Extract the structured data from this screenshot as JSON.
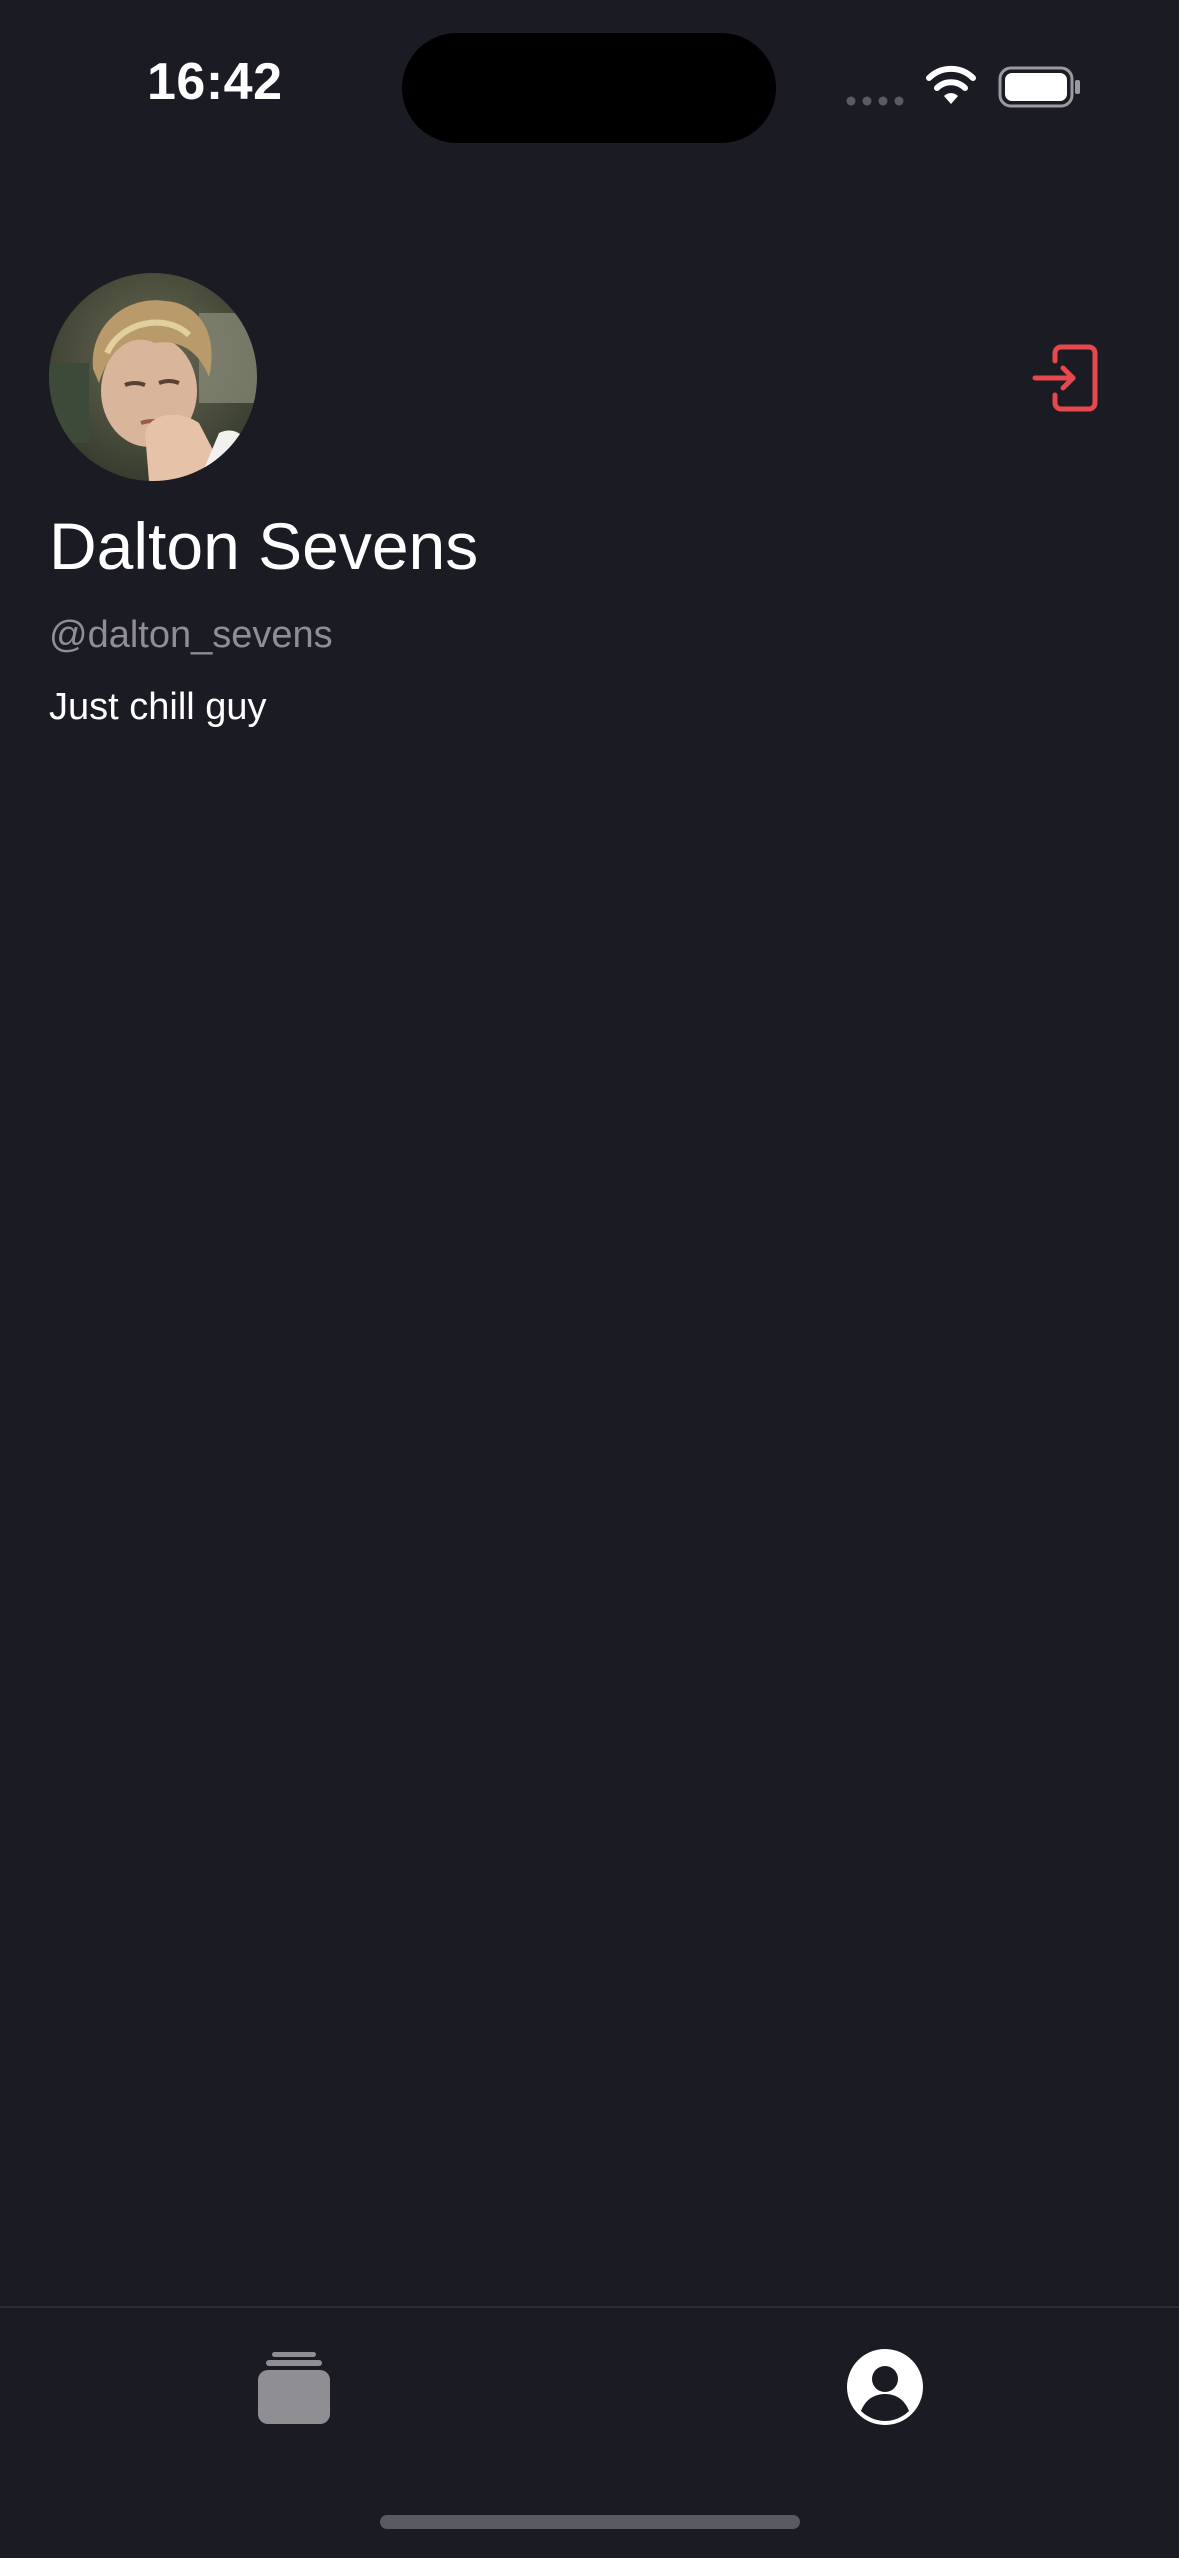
{
  "status_bar": {
    "time": "16:42",
    "signal_icon": "signal-dots-icon",
    "wifi_icon": "wifi-icon",
    "battery_icon": "battery-full-icon"
  },
  "profile": {
    "name": "Dalton Sevens",
    "handle": "@dalton_sevens",
    "bio": "Just chill guy",
    "avatar": "avatar-photo"
  },
  "header": {
    "logout_icon": "logout-icon",
    "accent_color": "#e5484d"
  },
  "tab_bar": {
    "tabs": [
      {
        "name": "feed",
        "icon": "stack-icon",
        "active": false
      },
      {
        "name": "profile",
        "icon": "person-circle-icon",
        "active": true
      }
    ],
    "active_color": "#ffffff",
    "inactive_color": "#8e8e93"
  },
  "colors": {
    "background": "#1b1b23",
    "text_primary": "#ffffff",
    "text_secondary": "#8e8e93"
  }
}
